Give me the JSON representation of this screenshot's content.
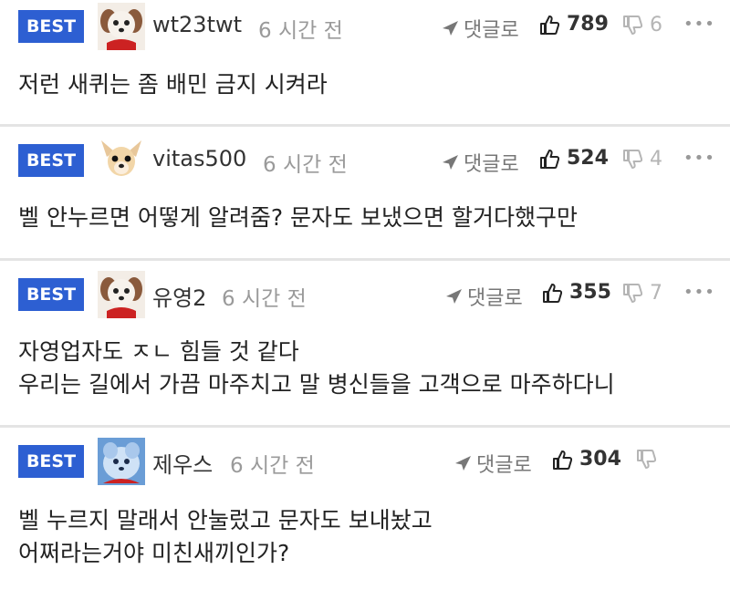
{
  "comments": [
    {
      "badge": "BEST",
      "avatar": "puppy-avatar",
      "nickname": "wt23twt",
      "time": "6 시간 전",
      "reply_label": "댓글로",
      "likes": "789",
      "dislikes": "6",
      "more": "•••",
      "text": "저런 새퀴는 좀 배민 금지 시켜라"
    },
    {
      "badge": "BEST",
      "avatar": "chihuahua-avatar",
      "nickname": "vitas500",
      "time": "6 시간 전",
      "reply_label": "댓글로",
      "likes": "524",
      "dislikes": "4",
      "more": "•••",
      "text": "벨 안누르면 어떻게 알려줌? 문자도 보냈으면 할거다했구만"
    },
    {
      "badge": "BEST",
      "avatar": "puppy-avatar",
      "nickname": "유영2",
      "time": "6 시간 전",
      "reply_label": "댓글로",
      "likes": "355",
      "dislikes": "7",
      "more": "•••",
      "text": "자영업자도 ㅈㄴ 힘들 것 같다\n우리는 길에서 가끔 마주치고 말 병신들을 고객으로 마주하다니"
    },
    {
      "badge": "BEST",
      "avatar": "blue-creature-avatar",
      "nickname": "제우스",
      "time": "6 시간 전",
      "reply_label": "댓글로",
      "likes": "304",
      "dislikes": "",
      "more": "",
      "text": "벨 누르지 말래서 안눌렀고 문자도 보내놨고\n어쩌라는거야 미친새끼인가?"
    }
  ],
  "colors": {
    "badge_bg": "#2d5fd2",
    "divider": "#e4e4e4",
    "muted": "#9a9a9a"
  }
}
